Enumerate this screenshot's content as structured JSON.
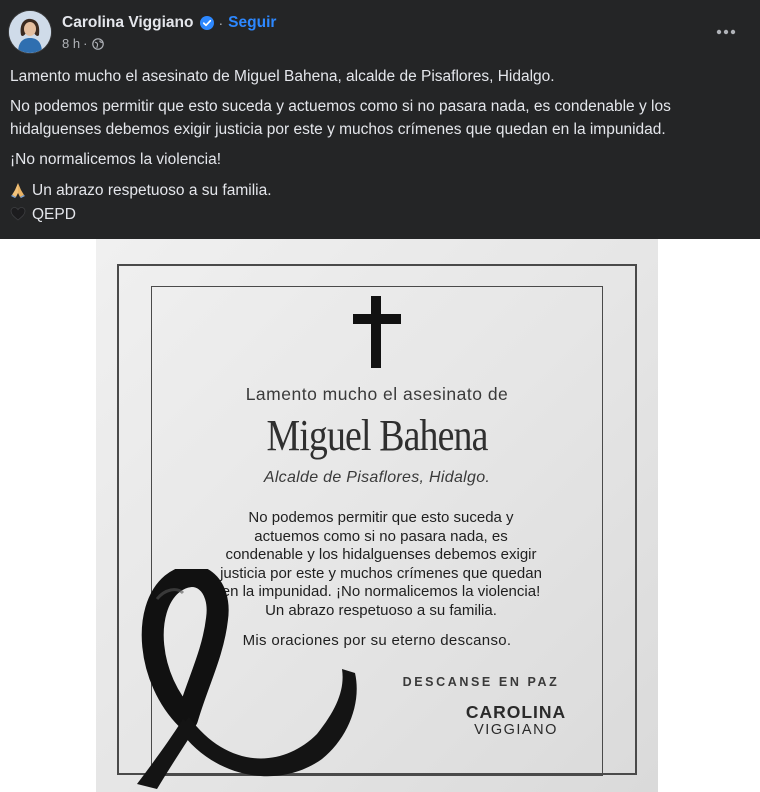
{
  "post": {
    "author": "Carolina Viggiano",
    "follow_label": "Seguir",
    "separator": "·",
    "time": "8 h",
    "paragraphs": [
      "Lamento mucho el asesinato de Miguel Bahena, alcalde de Pisaflores, Hidalgo.",
      "No podemos permitir que esto suceda y actuemos como si no pasara nada, es condenable y los hidalguenses debemos exigir justicia por este y muchos crímenes que quedan en la impunidad.",
      "¡No normalicemos la violencia!"
    ],
    "hug_line": "Un abrazo respetuoso a su familia.",
    "rip_line": "QEPD",
    "icons": [
      "verified-badge-icon",
      "globe-icon",
      "more-options-icon",
      "folded-hands-emoji",
      "black-heart-emoji"
    ],
    "colors": {
      "background": "#242526",
      "text": "#e4e6eb",
      "secondary_text": "#b0b3b8",
      "link": "#2d88ff"
    }
  },
  "card": {
    "intro": "Lamento mucho el asesinato de",
    "name": "Miguel Bahena",
    "title": "Alcalde de Pisaflores, Hidalgo.",
    "body_lines": [
      "No podemos permitir que esto suceda y",
      "actuemos como si no pasara nada, es",
      "condenable y los hidalguenses debemos exigir",
      "justicia por este y muchos crímenes que quedan",
      "en la impunidad. ¡No normalicemos la violencia!",
      "Un abrazo respetuoso a su familia."
    ],
    "prayer": "Mis oraciones por su eterno descanso.",
    "rip": "DESCANSE EN PAZ",
    "signature_first": "CAROLINA",
    "signature_last": "VIGGIANO",
    "icons": [
      "cross-icon",
      "mourning-ribbon-icon"
    ]
  }
}
